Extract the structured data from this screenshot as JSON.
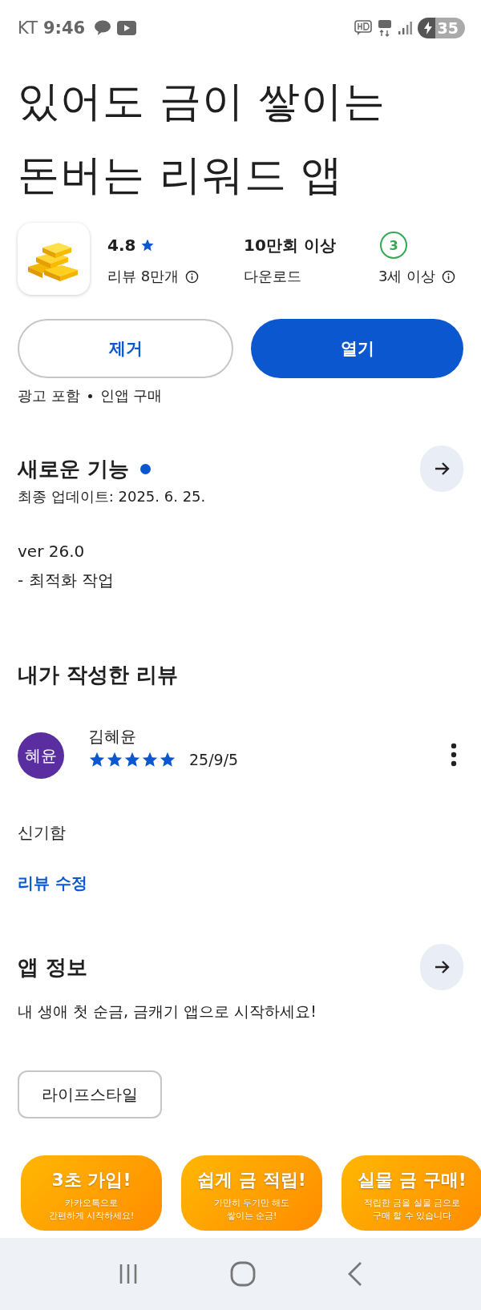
{
  "status_bar": {
    "carrier": "KT",
    "time": "9:46",
    "battery": "35"
  },
  "title_lines": [
    "있어도 금이 쌓이는",
    "돈버는 리워드 앱"
  ],
  "stats": {
    "rating": "4.8",
    "reviews": "리뷰 8만개",
    "downloads": "10만회 이상",
    "downloads_label": "다운로드",
    "age_badge": "3",
    "age_label": "3세 이상"
  },
  "buttons": [
    {
      "label": "제거",
      "kind": "outline"
    },
    {
      "label": "열기",
      "kind": "filled"
    }
  ],
  "ad_notes": [
    "광고 포함",
    "인앱 구매"
  ],
  "whats_new": {
    "title": "새로운 기능",
    "unread": true,
    "updated": "최종 업데이트: 2025. 6. 25.",
    "lines": [
      "ver 26.0",
      "- 최적화 작업"
    ]
  },
  "my_review": {
    "title": "내가 작성한 리뷰",
    "avatar_text": "혜윤",
    "author": "김혜윤",
    "stars": 5,
    "date": "25/9/5",
    "text": "신기함",
    "edit_link": "리뷰 수정"
  },
  "app_info": {
    "title": "앱 정보",
    "description": "내 생애 첫 순금, 금캐기 앱으로 시작하세요!",
    "tag": "라이프스타일"
  },
  "screenshots": [
    {
      "title": "3초 가입!",
      "lines": [
        "카카오톡으로",
        "간편하게 시작하세요!"
      ]
    },
    {
      "title": "쉽게 금 적립!",
      "lines": [
        "가만히 두기만 해도",
        "쌓이는 순금!"
      ]
    },
    {
      "title": "실물 금 구매!",
      "lines": [
        "적립한 금을 실물 금으로",
        "구매 할 수 있습니다"
      ]
    }
  ]
}
